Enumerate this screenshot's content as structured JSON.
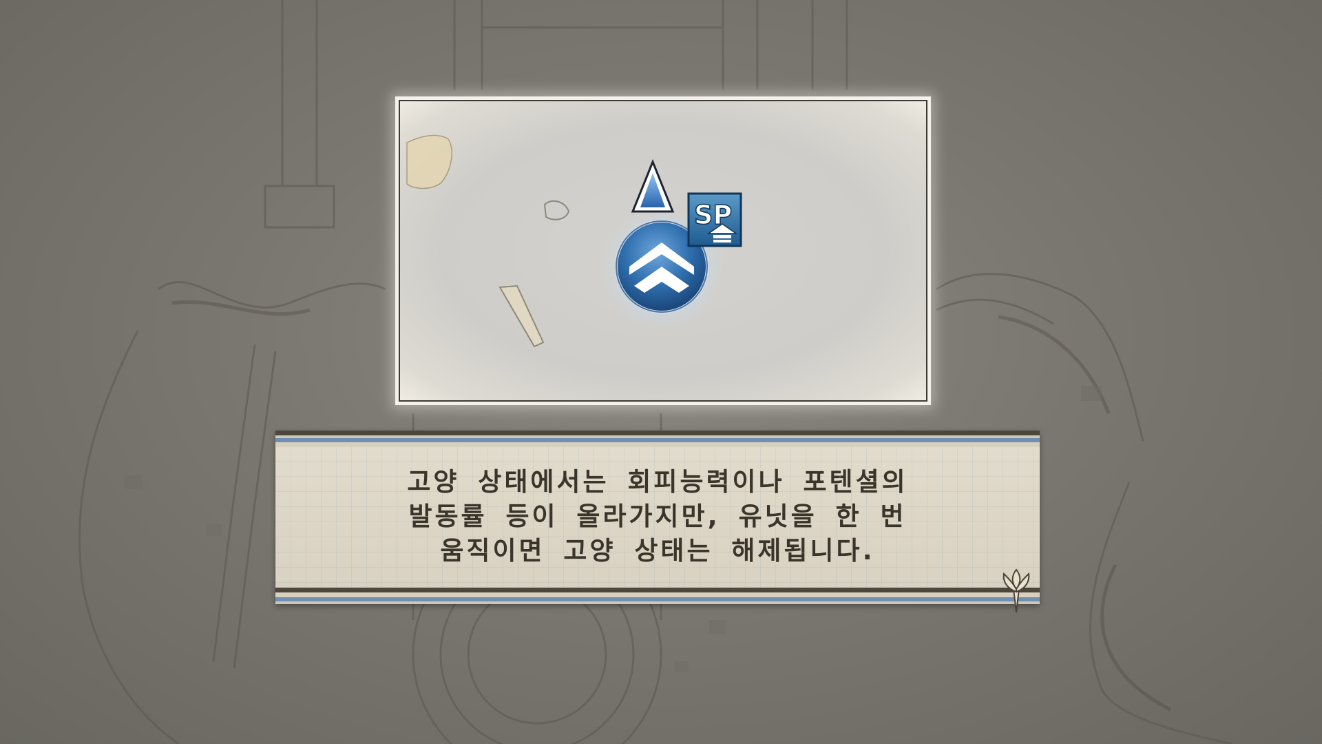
{
  "dialog": {
    "lines": [
      "고양 상태에서는 회피능력이나 포텐셜의",
      "발동률 등이 올라가지만, 유닛을 한 번",
      "움직이면 고양 상태는 해제됩니다."
    ]
  },
  "tutorial_image": {
    "badge_label": "SP",
    "icons": [
      "direction-arrow-icon",
      "unit-rank-chevron-icon",
      "sp-up-badge-icon"
    ]
  },
  "colors": {
    "text": "#3b342b",
    "accent_blue": "#2f6fae",
    "parchment": "#ddd6c6",
    "stripe_blue": "#6f8fb3"
  }
}
